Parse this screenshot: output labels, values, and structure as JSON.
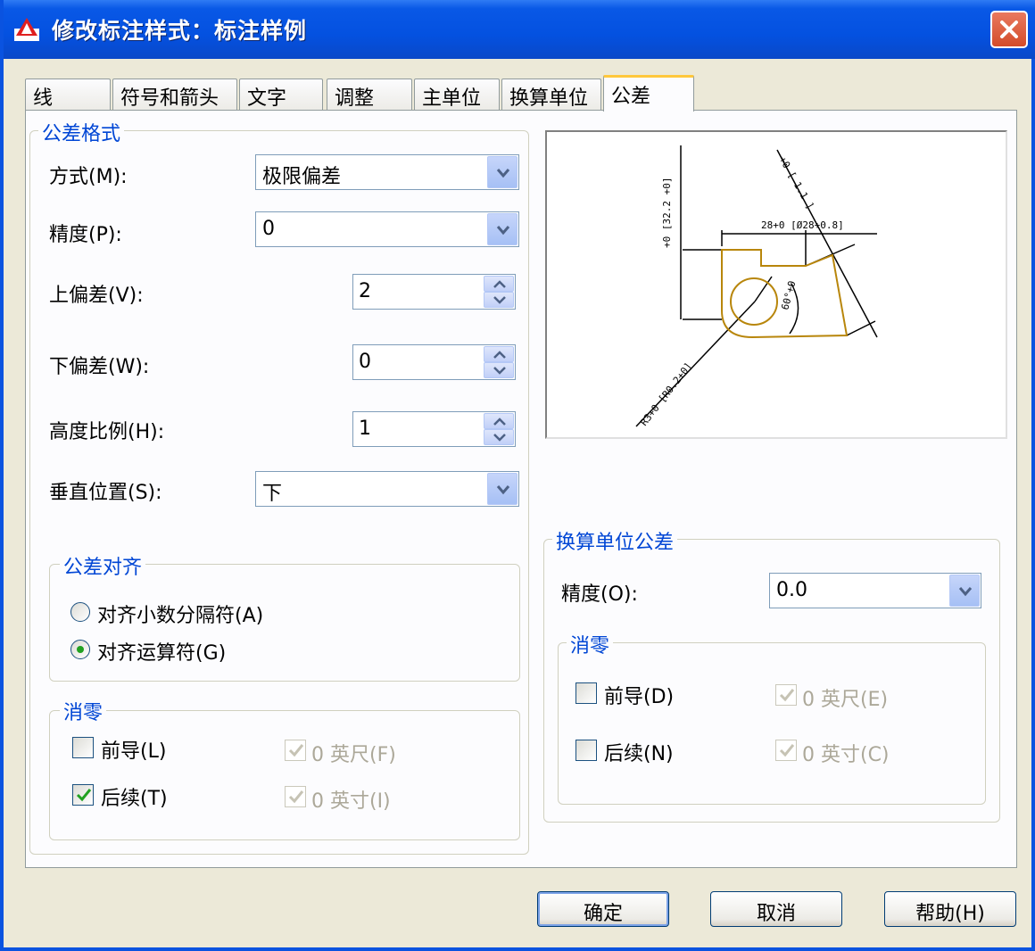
{
  "window": {
    "title": "修改标注样式：标注样例"
  },
  "tabs": [
    {
      "label": "线"
    },
    {
      "label": "符号和箭头"
    },
    {
      "label": "文字"
    },
    {
      "label": "调整"
    },
    {
      "label": "主单位"
    },
    {
      "label": "换算单位"
    },
    {
      "label": "公差"
    }
  ],
  "tolerance_format": {
    "title": "公差格式",
    "method_label": "方式(M):",
    "method_value": "极限偏差",
    "precision_label": "精度(P):",
    "precision_value": "0",
    "upper_label": "上偏差(V):",
    "upper_value": "2",
    "lower_label": "下偏差(W):",
    "lower_value": "0",
    "height_label": "高度比例(H):",
    "height_value": "1",
    "vertical_label": "垂直位置(S):",
    "vertical_value": "下"
  },
  "tolerance_align": {
    "title": "公差对齐",
    "option1": "对齐小数分隔符(A)",
    "option2": "对齐运算符(G)",
    "selected": 2
  },
  "zero_suppress_primary": {
    "title": "消零",
    "leading": "前导(L)",
    "trailing": "后续(T)",
    "feet": "0 英尺(F)",
    "inches": "0 英寸(I)",
    "leading_checked": false,
    "trailing_checked": true
  },
  "alt_unit_tolerance": {
    "title": "换算单位公差",
    "precision_label": "精度(O):",
    "precision_value": "0.0"
  },
  "zero_suppress_alt": {
    "title": "消零",
    "leading": "前导(D)",
    "trailing": "后续(N)",
    "feet": "0 英尺(E)",
    "inches": "0 英寸(C)",
    "leading_checked": false,
    "trailing_checked": false
  },
  "buttons": {
    "ok": "确定",
    "cancel": "取消",
    "help": "帮助(H)"
  },
  "colors": {
    "titlebar": "#0451e0",
    "group_title": "#0046d5",
    "preview_part": "#b8860b"
  }
}
